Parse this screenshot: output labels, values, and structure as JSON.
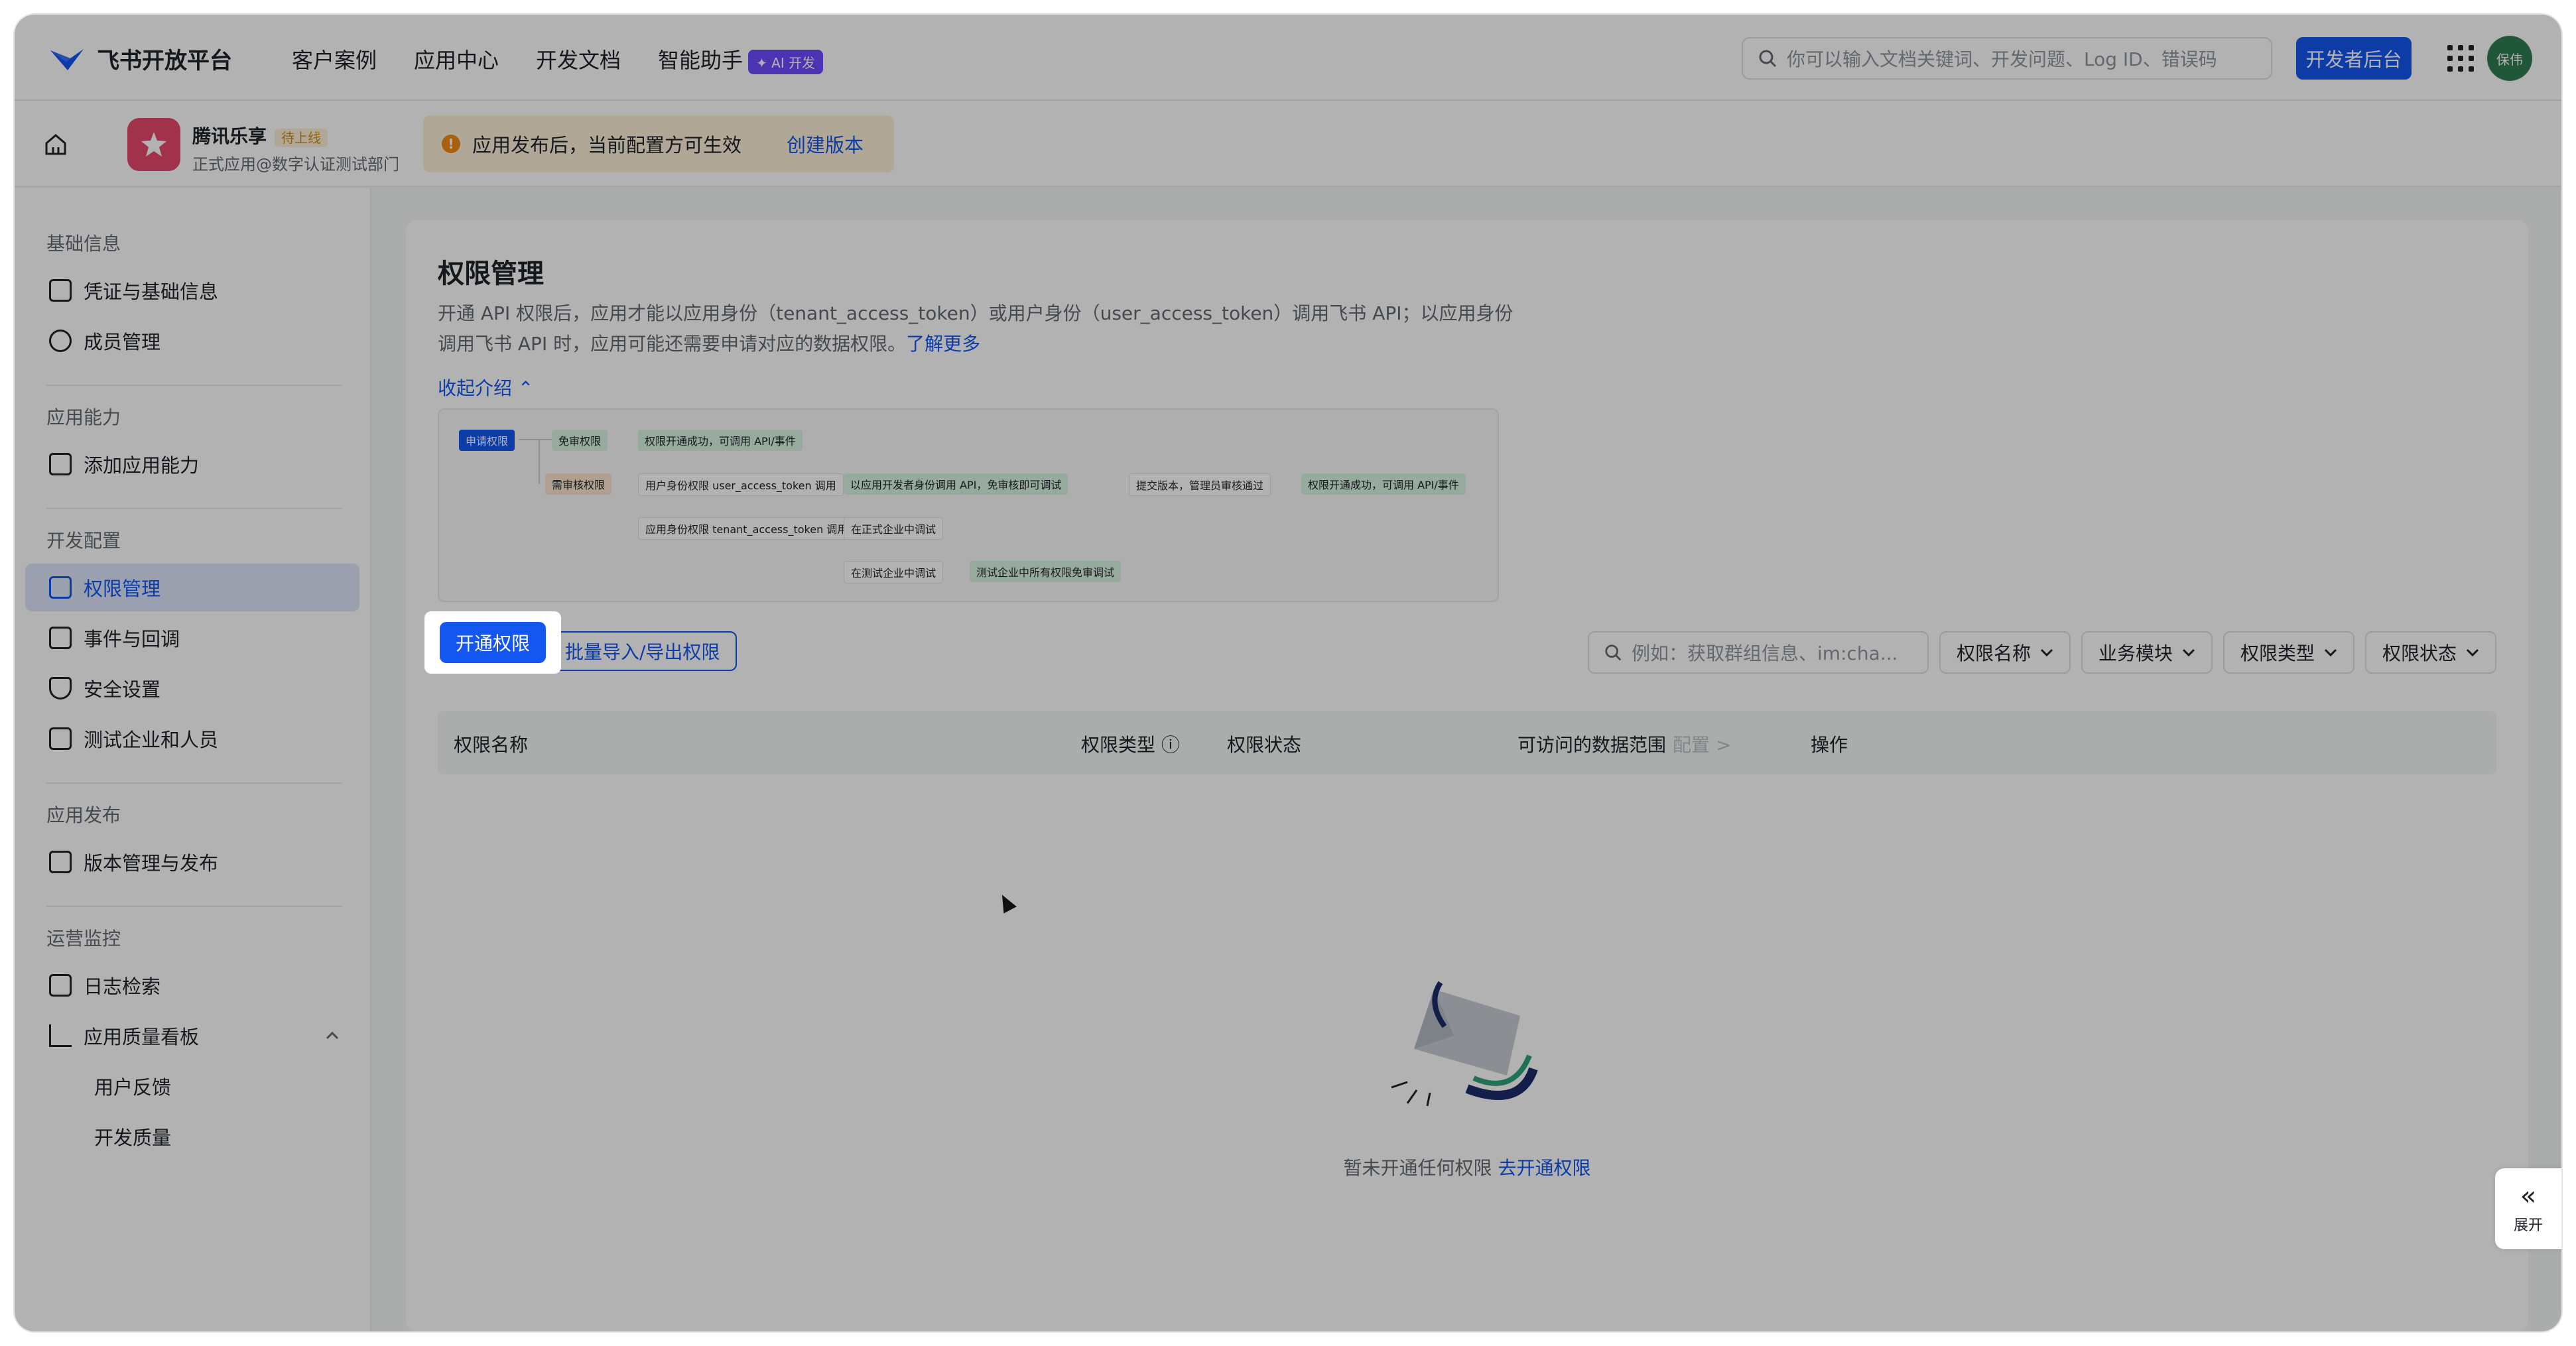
{
  "topbar": {
    "brand": "飞书开放平台",
    "nav": [
      "客户案例",
      "应用中心",
      "开发文档",
      "智能助手"
    ],
    "ai_badge": "✦ AI 开发",
    "search_placeholder": "你可以输入文档关键词、开发问题、Log ID、错误码",
    "dev_button": "开发者后台",
    "avatar_text": "保伟"
  },
  "app": {
    "name": "腾讯乐享",
    "status_tag": "待上线",
    "subtitle": "正式应用@数字认证测试部门",
    "notice": "应用发布后，当前配置方可生效",
    "notice_link": "创建版本"
  },
  "sidebar": {
    "groups": [
      "基础信息",
      "应用能力",
      "开发配置",
      "应用发布",
      "运营监控"
    ],
    "items": [
      {
        "label": "凭证与基础信息"
      },
      {
        "label": "成员管理"
      },
      {
        "label": "添加应用能力"
      },
      {
        "label": "权限管理"
      },
      {
        "label": "事件与回调"
      },
      {
        "label": "安全设置"
      },
      {
        "label": "测试企业和人员"
      },
      {
        "label": "版本管理与发布"
      },
      {
        "label": "日志检索"
      },
      {
        "label": "应用质量看板"
      },
      {
        "label": "用户反馈"
      },
      {
        "label": "开发质量"
      }
    ]
  },
  "main": {
    "title": "权限管理",
    "desc_text": "开通 API 权限后，应用才能以应用身份（tenant_access_token）或用户身份（user_access_token）调用飞书 API；以应用身份调用飞书 API 时，应用可能还需要申请对应的数据权限。",
    "desc_link": "了解更多",
    "collapse_label": "收起介绍 ⌃",
    "flow": {
      "apply": "申请权限",
      "free": "免审权限",
      "success": "权限开通成功，可调用 API/事件",
      "review": "需审核权限",
      "user_perm": "用户身份权限 user_access_token 调用",
      "app_perm": "应用身份权限 tenant_access_token 调用",
      "dev_call": "以应用开发者身份调用 API，免审核即可调试",
      "submit": "提交版本，管理员审核通过",
      "success2": "权限开通成功，可调用 API/事件",
      "prod_debug": "在正式企业中调试",
      "test_debug": "在测试企业中调试",
      "test_free": "测试企业中所有权限免审调试"
    },
    "open_button": "开通权限",
    "batch_button": "批量导入/导出权限",
    "filter_placeholder": "例如：获取群组信息、im:cha...",
    "filters": [
      "权限名称",
      "业务模块",
      "权限类型",
      "权限状态"
    ],
    "columns": [
      "权限名称",
      "权限类型",
      "权限状态",
      "可访问的数据范围",
      "配置 >",
      "操作"
    ],
    "empty_text": "暂未开通任何权限",
    "empty_link": "去开通权限",
    "expand_label": "展开"
  }
}
